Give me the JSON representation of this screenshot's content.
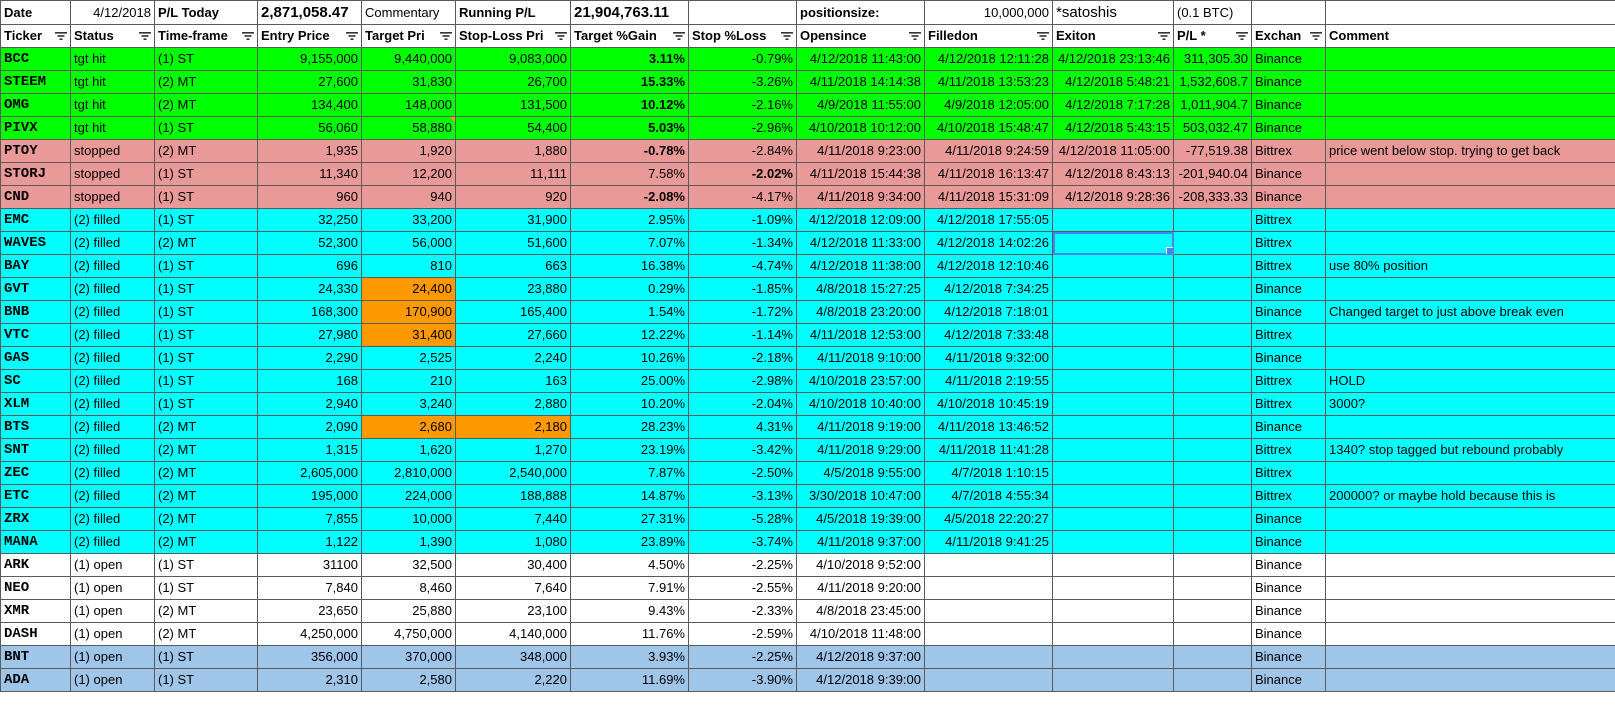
{
  "top": {
    "date_label": "Date",
    "date_value": "4/12/2018",
    "pl_today_label": "P/L Today",
    "pl_today_value": "2,871,058.47",
    "commentary_label": "Commentary",
    "running_pl_label": "Running P/L",
    "running_pl_value": "21,904,763.11",
    "positionsize_label": "positionsize:",
    "positionsize_value": "10,000,000",
    "unit_label": "*satoshis",
    "btc_label": "(0.1 BTC)"
  },
  "headers": [
    "Ticker",
    "Status",
    "Time-frame",
    "Entry Price",
    "Target Pri",
    "Stop-Loss Pri",
    "Target %Gain",
    "Stop %Loss",
    "Opensince",
    "Filledon",
    "Exiton",
    "P/L *",
    "Exchan",
    "Comment"
  ],
  "rows": [
    {
      "style": "green",
      "ticker": "BCC",
      "status": "tgt hit",
      "tf": "(1) ST",
      "entry": "9,155,000",
      "target": "9,440,000",
      "stop": "9,083,000",
      "gain": "3.11%",
      "loss": "-0.79%",
      "open": "4/12/2018 11:43:00",
      "filled": "4/12/2018 12:11:28",
      "exit": "4/12/2018 23:13:46",
      "pl": "311,305.30",
      "exch": "Binance",
      "comment": ""
    },
    {
      "style": "green",
      "ticker": "STEEM",
      "status": "tgt hit",
      "tf": "(2) MT",
      "entry": "27,600",
      "target": "31,830",
      "stop": "26,700",
      "gain": "15.33%",
      "loss": "-3.26%",
      "open": "4/11/2018 14:14:38",
      "filled": "4/11/2018 13:53:23",
      "exit": "4/12/2018 5:48:21",
      "pl": "1,532,608.7",
      "exch": "Binance",
      "comment": ""
    },
    {
      "style": "green",
      "ticker": "OMG",
      "status": "tgt hit",
      "tf": "(2) MT",
      "entry": "134,400",
      "target": "148,000",
      "stop": "131,500",
      "gain": "10.12%",
      "loss": "-2.16%",
      "open": "4/9/2018 11:55:00",
      "filled": "4/9/2018 12:05:00",
      "exit": "4/12/2018 7:17:28",
      "pl": "1,011,904.7",
      "exch": "Binance",
      "comment": ""
    },
    {
      "style": "green",
      "ticker": "PIVX",
      "status": "tgt hit",
      "tf": "(1) ST",
      "entry": "56,060",
      "target": "58,880",
      "stop": "54,400",
      "gain": "5.03%",
      "loss": "-2.96%",
      "open": "4/10/2018 10:12:00",
      "filled": "4/10/2018 15:48:47",
      "exit": "4/12/2018 5:43:15",
      "pl": "503,032.47",
      "exch": "Binance",
      "comment": ""
    },
    {
      "style": "red",
      "ticker": "PTOY",
      "status": "stopped",
      "tf": "(2) MT",
      "entry": "1,935",
      "target": "1,920",
      "stop": "1,880",
      "gain": "-0.78%",
      "loss": "-2.84%",
      "open": "4/11/2018 9:23:00",
      "filled": "4/11/2018 9:24:59",
      "exit": "4/12/2018 11:05:00",
      "pl": "-77,519.38",
      "exch": "Bittrex",
      "comment": "price went below stop. trying to get back"
    },
    {
      "style": "red",
      "ticker": "STORJ",
      "status": "stopped",
      "tf": "(1) ST",
      "entry": "11,340",
      "target": "12,200",
      "stop": "11,111",
      "gain": "7.58%",
      "loss": "-2.02%",
      "open": "4/11/2018 15:44:38",
      "filled": "4/11/2018 16:13:47",
      "exit": "4/12/2018 8:43:13",
      "pl": "-201,940.04",
      "exch": "Binance",
      "comment": ""
    },
    {
      "style": "red",
      "ticker": "CND",
      "status": "stopped",
      "tf": "(1) ST",
      "entry": "960",
      "target": "940",
      "stop": "920",
      "gain": "-2.08%",
      "loss": "-4.17%",
      "open": "4/11/2018 9:34:00",
      "filled": "4/11/2018 15:31:09",
      "exit": "4/12/2018 9:28:36",
      "pl": "-208,333.33",
      "exch": "Binance",
      "comment": ""
    },
    {
      "style": "cyan",
      "ticker": "EMC",
      "status": "(2) filled",
      "tf": "(1) ST",
      "entry": "32,250",
      "target": "33,200",
      "stop": "31,900",
      "gain": "2.95%",
      "loss": "-1.09%",
      "open": "4/12/2018 12:09:00",
      "filled": "4/12/2018 17:55:05",
      "exit": "",
      "pl": "",
      "exch": "Bittrex",
      "comment": ""
    },
    {
      "style": "cyan",
      "ticker": "WAVES",
      "status": "(2) filled",
      "tf": "(2) MT",
      "entry": "52,300",
      "target": "56,000",
      "stop": "51,600",
      "gain": "7.07%",
      "loss": "-1.34%",
      "open": "4/12/2018 11:33:00",
      "filled": "4/12/2018 14:02:26",
      "exit": "",
      "pl": "",
      "exch": "Bittrex",
      "comment": ""
    },
    {
      "style": "cyan",
      "ticker": "BAY",
      "status": "(2) filled",
      "tf": "(1) ST",
      "entry": "696",
      "target": "810",
      "stop": "663",
      "gain": "16.38%",
      "loss": "-4.74%",
      "open": "4/12/2018 11:38:00",
      "filled": "4/12/2018 12:10:46",
      "exit": "",
      "pl": "",
      "exch": "Bittrex",
      "comment": "use 80% position"
    },
    {
      "style": "cyan",
      "ticker": "GVT",
      "status": "(2) filled",
      "tf": "(1) ST",
      "entry": "24,330",
      "target": "24,400",
      "stop": "23,880",
      "gain": "0.29%",
      "loss": "-1.85%",
      "open": "4/8/2018 15:27:25",
      "filled": "4/12/2018 7:34:25",
      "exit": "",
      "pl": "",
      "exch": "Binance",
      "comment": ""
    },
    {
      "style": "cyan",
      "ticker": "BNB",
      "status": "(2) filled",
      "tf": "(1) ST",
      "entry": "168,300",
      "target": "170,900",
      "stop": "165,400",
      "gain": "1.54%",
      "loss": "-1.72%",
      "open": "4/8/2018 23:20:00",
      "filled": "4/12/2018 7:18:01",
      "exit": "",
      "pl": "",
      "exch": "Binance",
      "comment": "Changed target to just above break even"
    },
    {
      "style": "cyan",
      "ticker": "VTC",
      "status": "(2) filled",
      "tf": "(1) ST",
      "entry": "27,980",
      "target": "31,400",
      "stop": "27,660",
      "gain": "12.22%",
      "loss": "-1.14%",
      "open": "4/11/2018 12:53:00",
      "filled": "4/12/2018 7:33:48",
      "exit": "",
      "pl": "",
      "exch": "Bittrex",
      "comment": ""
    },
    {
      "style": "cyan",
      "ticker": "GAS",
      "status": "(2) filled",
      "tf": "(1) ST",
      "entry": "2,290",
      "target": "2,525",
      "stop": "2,240",
      "gain": "10.26%",
      "loss": "-2.18%",
      "open": "4/11/2018 9:10:00",
      "filled": "4/11/2018 9:32:00",
      "exit": "",
      "pl": "",
      "exch": "Binance",
      "comment": ""
    },
    {
      "style": "cyan",
      "ticker": "SC",
      "status": "(2) filled",
      "tf": "(1) ST",
      "entry": "168",
      "target": "210",
      "stop": "163",
      "gain": "25.00%",
      "loss": "-2.98%",
      "open": "4/10/2018 23:57:00",
      "filled": "4/11/2018 2:19:55",
      "exit": "",
      "pl": "",
      "exch": "Bittrex",
      "comment": "HOLD"
    },
    {
      "style": "cyan",
      "ticker": "XLM",
      "status": "(2) filled",
      "tf": "(1) ST",
      "entry": "2,940",
      "target": "3,240",
      "stop": "2,880",
      "gain": "10.20%",
      "loss": "-2.04%",
      "open": "4/10/2018 10:40:00",
      "filled": "4/10/2018 10:45:19",
      "exit": "",
      "pl": "",
      "exch": "Bittrex",
      "comment": "3000?"
    },
    {
      "style": "cyan",
      "ticker": "BTS",
      "status": "(2) filled",
      "tf": "(2) MT",
      "entry": "2,090",
      "target": "2,680",
      "stop": "2,180",
      "gain": "28.23%",
      "loss": "4.31%",
      "open": "4/11/2018 9:19:00",
      "filled": "4/11/2018 13:46:52",
      "exit": "",
      "pl": "",
      "exch": "Binance",
      "comment": ""
    },
    {
      "style": "cyan",
      "ticker": "SNT",
      "status": "(2) filled",
      "tf": "(2) MT",
      "entry": "1,315",
      "target": "1,620",
      "stop": "1,270",
      "gain": "23.19%",
      "loss": "-3.42%",
      "open": "4/11/2018 9:29:00",
      "filled": "4/11/2018 11:41:28",
      "exit": "",
      "pl": "",
      "exch": "Bittrex",
      "comment": "1340? stop tagged but rebound probably"
    },
    {
      "style": "cyan",
      "ticker": "ZEC",
      "status": "(2) filled",
      "tf": "(2) MT",
      "entry": "2,605,000",
      "target": "2,810,000",
      "stop": "2,540,000",
      "gain": "7.87%",
      "loss": "-2.50%",
      "open": "4/5/2018 9:55:00",
      "filled": "4/7/2018 1:10:15",
      "exit": "",
      "pl": "",
      "exch": "Bittrex",
      "comment": ""
    },
    {
      "style": "cyan",
      "ticker": "ETC",
      "status": "(2) filled",
      "tf": "(2) MT",
      "entry": "195,000",
      "target": "224,000",
      "stop": "188,888",
      "gain": "14.87%",
      "loss": "-3.13%",
      "open": "3/30/2018 10:47:00",
      "filled": "4/7/2018 4:55:34",
      "exit": "",
      "pl": "",
      "exch": "Bittrex",
      "comment": "200000? or maybe hold because this is"
    },
    {
      "style": "cyan",
      "ticker": "ZRX",
      "status": "(2) filled",
      "tf": "(2) MT",
      "entry": "7,855",
      "target": "10,000",
      "stop": "7,440",
      "gain": "27.31%",
      "loss": "-5.28%",
      "open": "4/5/2018 19:39:00",
      "filled": "4/5/2018 22:20:27",
      "exit": "",
      "pl": "",
      "exch": "Binance",
      "comment": ""
    },
    {
      "style": "cyan",
      "ticker": "MANA",
      "status": "(2) filled",
      "tf": "(2) MT",
      "entry": "1,122",
      "target": "1,390",
      "stop": "1,080",
      "gain": "23.89%",
      "loss": "-3.74%",
      "open": "4/11/2018 9:37:00",
      "filled": "4/11/2018 9:41:25",
      "exit": "",
      "pl": "",
      "exch": "Binance",
      "comment": ""
    },
    {
      "style": "white",
      "ticker": "ARK",
      "status": "(1) open",
      "tf": "(1) ST",
      "entry": "31100",
      "target": "32,500",
      "stop": "30,400",
      "gain": "4.50%",
      "loss": "-2.25%",
      "open": "4/10/2018 9:52:00",
      "filled": "",
      "exit": "",
      "pl": "",
      "exch": "Binance",
      "comment": ""
    },
    {
      "style": "white",
      "ticker": "NEO",
      "status": "(1) open",
      "tf": "(1) ST",
      "entry": "7,840",
      "target": "8,460",
      "stop": "7,640",
      "gain": "7.91%",
      "loss": "-2.55%",
      "open": "4/11/2018 9:20:00",
      "filled": "",
      "exit": "",
      "pl": "",
      "exch": "Binance",
      "comment": ""
    },
    {
      "style": "white",
      "ticker": "XMR",
      "status": "(1) open",
      "tf": "(2) MT",
      "entry": "23,650",
      "target": "25,880",
      "stop": "23,100",
      "gain": "9.43%",
      "loss": "-2.33%",
      "open": "4/8/2018 23:45:00",
      "filled": "",
      "exit": "",
      "pl": "",
      "exch": "Binance",
      "comment": ""
    },
    {
      "style": "white",
      "ticker": "DASH",
      "status": "(1) open",
      "tf": "(2) MT",
      "entry": "4,250,000",
      "target": "4,750,000",
      "stop": "4,140,000",
      "gain": "11.76%",
      "loss": "-2.59%",
      "open": "4/10/2018 11:48:00",
      "filled": "",
      "exit": "",
      "pl": "",
      "exch": "Binance",
      "comment": ""
    },
    {
      "style": "blue",
      "ticker": "BNT",
      "status": "(1) open",
      "tf": "(1) ST",
      "entry": "356,000",
      "target": "370,000",
      "stop": "348,000",
      "gain": "3.93%",
      "loss": "-2.25%",
      "open": "4/12/2018 9:37:00",
      "filled": "",
      "exit": "",
      "pl": "",
      "exch": "Binance",
      "comment": ""
    },
    {
      "style": "blue",
      "ticker": "ADA",
      "status": "(1) open",
      "tf": "(1) ST",
      "entry": "2,310",
      "target": "2,580",
      "stop": "2,220",
      "gain": "11.69%",
      "loss": "-3.90%",
      "open": "4/12/2018 9:39:00",
      "filled": "",
      "exit": "",
      "pl": "",
      "exch": "Binance",
      "comment": ""
    }
  ],
  "colors": {
    "green": "#00ff00",
    "red": "#ea9999",
    "cyan": "#00ffff",
    "blue": "#9fc5e8",
    "orange": "#ff9900",
    "selection": "#4a86e8"
  }
}
